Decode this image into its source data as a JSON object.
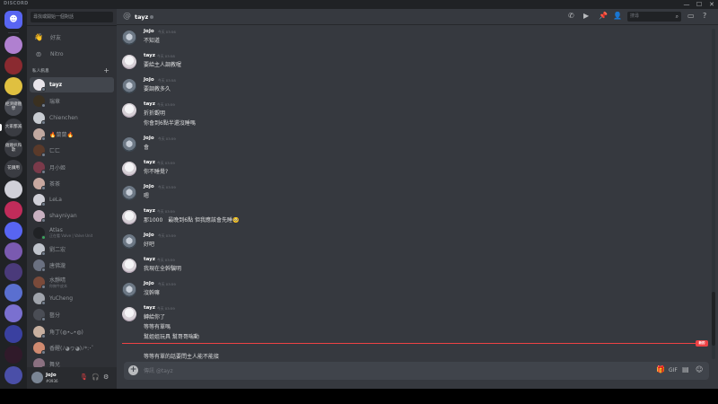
{
  "window": {
    "app_name": "DISCORD",
    "buttons": [
      "—",
      "☐",
      "✕"
    ]
  },
  "guilds": [
    {
      "kind": "home",
      "icon": "discord-logo-icon",
      "color": "#5865f2"
    },
    {
      "kind": "server",
      "label": "",
      "color": "#b080d0"
    },
    {
      "kind": "server",
      "label": "",
      "color": "#8a2a30"
    },
    {
      "kind": "server",
      "label": "",
      "color": "#e0c040"
    },
    {
      "kind": "server",
      "label": "經濟總體學",
      "color": "#4a4d55"
    },
    {
      "kind": "server",
      "label": "大家都滅",
      "color": "#3a3c42"
    },
    {
      "kind": "server",
      "label": "雞雞扒和歌",
      "color": "#3a3c42"
    },
    {
      "kind": "server",
      "label": "花鑽用",
      "color": "#3a3c42"
    },
    {
      "kind": "server",
      "label": "",
      "color": "#d0d0d8"
    },
    {
      "kind": "server",
      "label": "",
      "color": "#c02c5a"
    },
    {
      "kind": "server",
      "label": "",
      "color": "#5865f2"
    },
    {
      "kind": "server",
      "label": "",
      "color": "#7a5ab0"
    },
    {
      "kind": "server",
      "label": "",
      "color": "#4a3a7a"
    },
    {
      "kind": "server",
      "label": "",
      "color": "#5a6fd0"
    },
    {
      "kind": "server",
      "label": "",
      "color": "#7a70d0"
    },
    {
      "kind": "server",
      "label": "",
      "color": "#3a40a0"
    },
    {
      "kind": "server",
      "label": "",
      "color": "#301a2a"
    },
    {
      "kind": "server",
      "label": "",
      "color": "#4a4fa8"
    }
  ],
  "sidebar": {
    "search_placeholder": "尋找或開始一個對話",
    "nav": [
      {
        "label": "好友",
        "icon": "friends-icon"
      },
      {
        "label": "Nitro",
        "icon": "nitro-icon"
      }
    ],
    "dm_header": "私人訊息",
    "dm_add": "+",
    "dms": [
      {
        "name": "tayz",
        "sub": "",
        "active": true,
        "color": "#e8e4ea",
        "status": "#747f8d"
      },
      {
        "name": "瑞章",
        "sub": "",
        "active": false,
        "color": "#3a3020",
        "status": "#747f8d"
      },
      {
        "name": "Chienchen",
        "sub": "",
        "active": false,
        "color": "#c8ccd2",
        "status": "#747f8d"
      },
      {
        "name": "🔥蘭蘭🔥",
        "sub": "",
        "active": false,
        "color": "#c0a8a0",
        "status": "#747f8d"
      },
      {
        "name": "ㄈㄈ",
        "sub": "",
        "active": false,
        "color": "#5a3a2a",
        "status": "#747f8d"
      },
      {
        "name": "月小姬",
        "sub": "",
        "active": false,
        "color": "#7a3a4a",
        "status": "#747f8d"
      },
      {
        "name": "茶茶",
        "sub": "",
        "active": false,
        "color": "#c8a8a0",
        "status": "#747f8d"
      },
      {
        "name": "LeLa",
        "sub": "",
        "active": false,
        "color": "#d0d0d8",
        "status": "#747f8d"
      },
      {
        "name": "shayniyan",
        "sub": "",
        "active": false,
        "color": "#c8b0c0",
        "status": "#747f8d"
      },
      {
        "name": "Atlas",
        "sub": "正在看 Valve | Valve Unit",
        "active": false,
        "color": "#202225",
        "status": "#3ba55d"
      },
      {
        "name": "劉二宏",
        "sub": "",
        "active": false,
        "color": "#c0c4cc",
        "status": "#747f8d"
      },
      {
        "name": "唐佛瀧",
        "sub": "",
        "active": false,
        "color": "#6a7080",
        "status": "#747f8d"
      },
      {
        "name": "水靜晴",
        "sub": "你無牛皮本",
        "active": false,
        "color": "#7a4a3a",
        "status": "#747f8d"
      },
      {
        "name": "YuCheng",
        "sub": "",
        "active": false,
        "color": "#a0a4ac",
        "status": "#747f8d"
      },
      {
        "name": "藝分",
        "sub": "",
        "active": false,
        "color": "#4a4d55",
        "status": "#747f8d"
      },
      {
        "name": "角丁(◍•ᴗ•◍)",
        "sub": "",
        "active": false,
        "color": "#c8b0a0",
        "status": "#747f8d"
      },
      {
        "name": "香醒(ﾉ◕ヮ◕)ﾉ*:･ﾟ",
        "sub": "",
        "active": false,
        "color": "#d08a70",
        "status": "#747f8d"
      },
      {
        "name": "舞兒",
        "sub": "",
        "active": false,
        "color": "#8a7080",
        "status": "#747f8d"
      }
    ]
  },
  "user_panel": {
    "name": "JoJo",
    "tag": "#0936"
  },
  "chat": {
    "header_name": "tayz",
    "search_placeholder": "搜尋",
    "messages": [
      {
        "author": "JoJo",
        "avatar": "jojo",
        "time": "今天 03:56",
        "lines": [
          "不知道"
        ]
      },
      {
        "author": "tayz",
        "avatar": "tayz",
        "time": "今天 03:58",
        "lines": [
          "要給主人調教喔"
        ]
      },
      {
        "author": "JoJo",
        "avatar": "jojo",
        "time": "今天 03:58",
        "lines": [
          "要調教多久"
        ]
      },
      {
        "author": "tayz",
        "avatar": "tayz",
        "time": "今天 03:59",
        "lines": [
          "折折觀明",
          "你會到6點半還沒睡嗎"
        ]
      },
      {
        "author": "JoJo",
        "avatar": "jojo",
        "time": "今天 03:59",
        "lines": [
          "會"
        ]
      },
      {
        "author": "tayz",
        "avatar": "tayz",
        "time": "今天 03:59",
        "lines": [
          "你不睡覺?"
        ]
      },
      {
        "author": "JoJo",
        "avatar": "jojo",
        "time": "今天 03:59",
        "lines": [
          "嗯"
        ]
      },
      {
        "author": "tayz",
        "avatar": "tayz",
        "time": "今天 03:59",
        "lines": [
          "那1000　最晚到6點 但我應該會先睡🥺"
        ]
      },
      {
        "author": "JoJo",
        "avatar": "jojo",
        "time": "今天 03:59",
        "lines": [
          "好吧"
        ]
      },
      {
        "author": "tayz",
        "avatar": "tayz",
        "time": "今天 03:59",
        "lines": [
          "我現在全幹騙明"
        ]
      },
      {
        "author": "JoJo",
        "avatar": "jojo",
        "time": "今天 03:59",
        "lines": [
          "沒幹嘛"
        ]
      },
      {
        "author": "tayz",
        "avatar": "tayz",
        "time": "今天 03:59",
        "lines": [
          "轉給你了",
          "等等有單嗎",
          "幫姐姐玩具 幫哥哥喘動",
          "等等有單的話要問主人能不能接"
        ]
      }
    ],
    "new_badge": "新的",
    "composer_placeholder": "傳訊 @tayz"
  }
}
